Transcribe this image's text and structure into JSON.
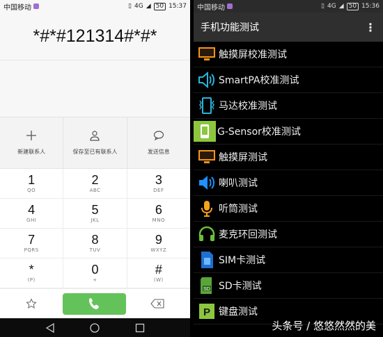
{
  "left": {
    "status": {
      "carrier": "中国移动",
      "signal": "4G",
      "battery": "50",
      "time": "15:37"
    },
    "dialed": "*#*#121314#*#*",
    "actions": [
      {
        "label": "新建联系人",
        "icon": "plus-icon"
      },
      {
        "label": "保存至已有联系人",
        "icon": "person-icon"
      },
      {
        "label": "发送信息",
        "icon": "message-icon"
      }
    ],
    "keys": [
      [
        {
          "d": "1",
          "l": "QO"
        },
        {
          "d": "2",
          "l": "ABC"
        },
        {
          "d": "3",
          "l": "DEF"
        }
      ],
      [
        {
          "d": "4",
          "l": "GHI"
        },
        {
          "d": "5",
          "l": "JKL"
        },
        {
          "d": "6",
          "l": "MNO"
        }
      ],
      [
        {
          "d": "7",
          "l": "PQRS"
        },
        {
          "d": "8",
          "l": "TUV"
        },
        {
          "d": "9",
          "l": "WXYZ"
        }
      ],
      [
        {
          "d": "*",
          "l": "(P)"
        },
        {
          "d": "0",
          "l": "+"
        },
        {
          "d": "#",
          "l": "(W)"
        }
      ]
    ]
  },
  "right": {
    "status": {
      "carrier": "中国移动",
      "signal": "4G",
      "battery": "50",
      "time": "15:36"
    },
    "title": "手机功能测试",
    "items": [
      {
        "label": "触摸屏校准测试",
        "icon": "monitor-icon"
      },
      {
        "label": "SmartPA校准测试",
        "icon": "speaker-icon"
      },
      {
        "label": "马达校准测试",
        "icon": "vibration-icon"
      },
      {
        "label": "G-Sensor校准测试",
        "icon": "phone-sensor-icon"
      },
      {
        "label": "触摸屏测试",
        "icon": "monitor-icon"
      },
      {
        "label": "喇叭测试",
        "icon": "loudspeaker-icon"
      },
      {
        "label": "听筒测试",
        "icon": "microphone-icon"
      },
      {
        "label": "麦克环回测试",
        "icon": "headset-icon"
      },
      {
        "label": "SIM卡测试",
        "icon": "sim-card-icon"
      },
      {
        "label": "SD卡测试",
        "icon": "sd-card-icon"
      },
      {
        "label": "键盘测试",
        "icon": "keyboard-p-icon"
      }
    ]
  },
  "watermark": "头条号 / 悠悠然然的美",
  "colors": {
    "call_green": "#64c25a",
    "orange": "#f7941d",
    "blue": "#1e90ff",
    "lime": "#8cc63f"
  }
}
